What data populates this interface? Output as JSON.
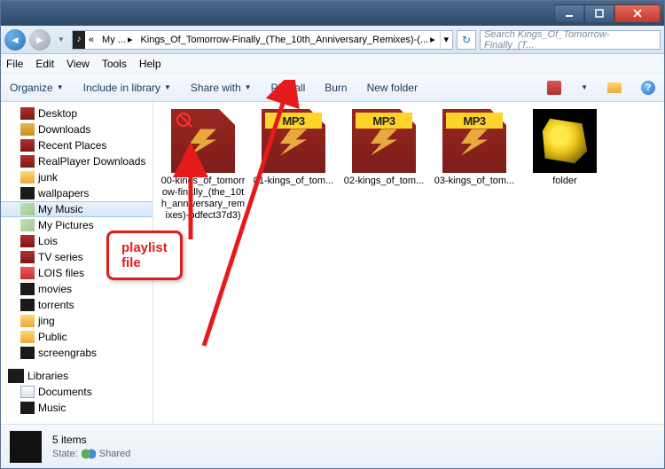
{
  "breadcrumb": {
    "root": "My ...",
    "folder": "Kings_Of_Tomorrow-Finally_(The_10th_Anniversary_Remixes)-(..."
  },
  "search": {
    "placeholder": "Search Kings_Of_Tomorrow-Finally_(T..."
  },
  "menus": {
    "file": "File",
    "edit": "Edit",
    "view": "View",
    "tools": "Tools",
    "help": "Help"
  },
  "toolbar": {
    "organize": "Organize",
    "include": "Include in library",
    "share": "Share with",
    "playall": "Play all",
    "burn": "Burn",
    "newfolder": "New folder"
  },
  "tree": {
    "desktop": "Desktop",
    "downloads": "Downloads",
    "recent": "Recent Places",
    "realplayer": "RealPlayer Downloads",
    "junk": "junk",
    "wallpapers": "wallpapers",
    "mymusic": "My Music",
    "mypictures": "My Pictures",
    "lois": "Lois",
    "tvseries": "TV series",
    "loisfiles": "LOIS files",
    "movies": "movies",
    "torrents": "torrents",
    "jing": "jing",
    "public": "Public",
    "screengrabs": "screengrabs",
    "libraries": "Libraries",
    "documents": "Documents",
    "music": "Music"
  },
  "items": {
    "file0": "00-kings_of_tomorrow-finally_(the_10th_anniversary_remixes)-bdfect37d3)",
    "file1": "01-kings_of_tom...",
    "file2": "02-kings_of_tom...",
    "file3": "03-kings_of_tom...",
    "folder": "folder",
    "mp3": "MP3"
  },
  "details": {
    "count": "5 items",
    "state_label": "State:",
    "state_value": "Shared"
  },
  "annotation": {
    "line1": "playlist",
    "line2": "file"
  }
}
